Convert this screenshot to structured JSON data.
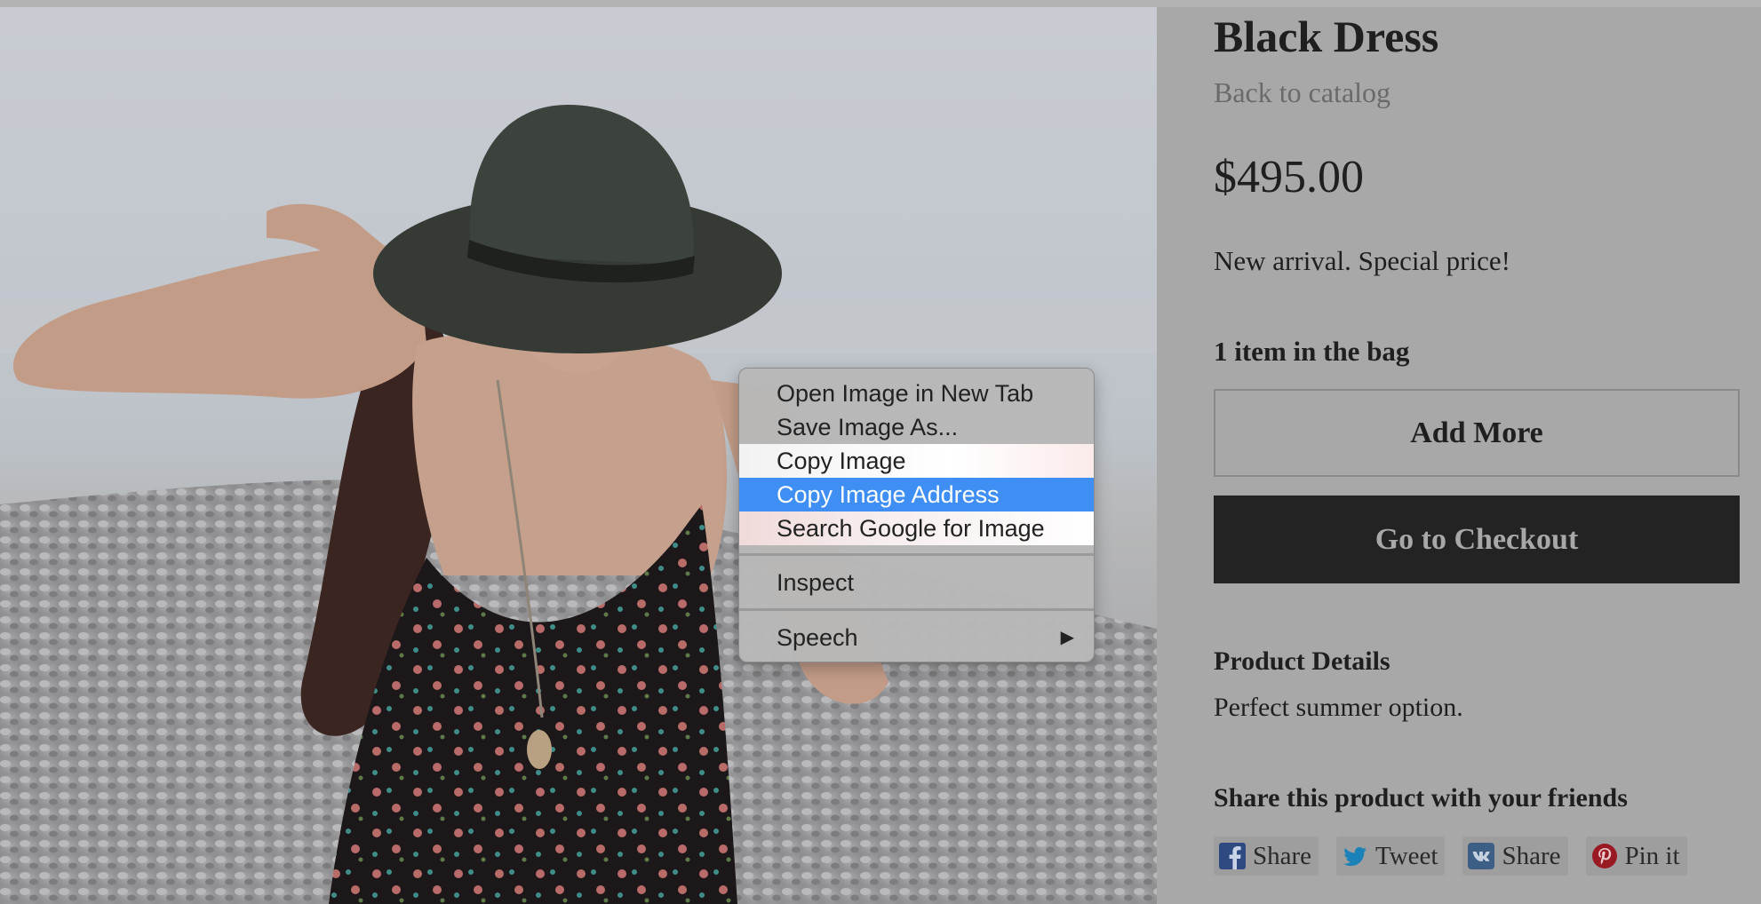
{
  "product": {
    "title": "Black Dress",
    "back_link": "Back to catalog",
    "price": "$495.00",
    "description": "New arrival. Special price!",
    "bag_status": "1 item in the bag",
    "add_more_label": "Add More",
    "checkout_label": "Go to Checkout",
    "details_heading": "Product Details",
    "details_text": "Perfect summer option.",
    "share_heading": "Share this product with your friends",
    "share_buttons": [
      {
        "label": "Share",
        "icon": "facebook-icon",
        "color": "#3b5998"
      },
      {
        "label": "Tweet",
        "icon": "twitter-icon",
        "color": "#1da1f2"
      },
      {
        "label": "Share",
        "icon": "vk-icon",
        "color": "#4a76a8"
      },
      {
        "label": "Pin it",
        "icon": "pinterest-icon",
        "color": "#bd081c"
      }
    ]
  },
  "context_menu": {
    "items": [
      {
        "label": "Open Image in New Tab"
      },
      {
        "label": "Save Image As..."
      },
      {
        "label": "Copy Image"
      },
      {
        "label": "Copy Image Address",
        "highlighted": true
      },
      {
        "label": "Search Google for Image"
      },
      {
        "label": "Inspect"
      },
      {
        "label": "Speech",
        "has_submenu": true
      }
    ],
    "highlight_color": "#3e8ef3"
  },
  "colors": {
    "overlay_background": "#a8a8a8",
    "checkout_button": "#232323"
  }
}
